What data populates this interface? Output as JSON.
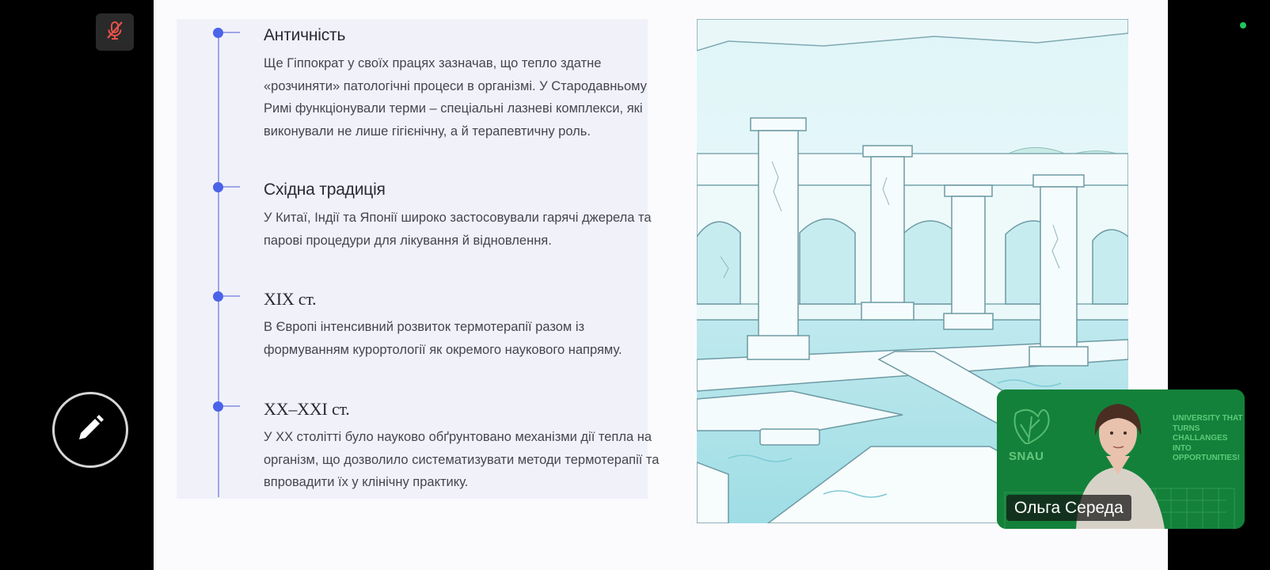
{
  "controls": {
    "mic_icon": "microphone-muted-icon",
    "edit_icon": "pencil-icon",
    "mic_color": "#e8524a"
  },
  "slide": {
    "timeline": [
      {
        "heading": "Античність",
        "text": "Ще Гіппократ у своїх працях зазначав, що тепло здатне «розчиняти» патологічні процеси в організмі. У Стародавньому Римі функціонували терми – спеціальні лазневі комплекси, які виконували не лише гігієнічну, а й терапевтичну роль."
      },
      {
        "heading": "Східна традиція",
        "text": "У Китаї, Індії та Японії широко застосовували гарячі джерела та парові процедури для лікування й відновлення."
      },
      {
        "heading": "XIX ст.",
        "text": "В Європі інтенсивний розвиток термотерапії разом із формуванням курортології як окремого наукового напряму."
      },
      {
        "heading": "XX–XXI ст.",
        "text": "У XX столітті було науково обґрунтовано механізми дії тепла на організм, що дозволило систематизувати методи термотерапії та впровадити їх у клінічну практику."
      }
    ],
    "accent_color": "#4a63e8"
  },
  "camera": {
    "participant_name": "Ольга Середа",
    "logo_text": "SNAU",
    "slogan": "UNIVERSITY THAT TURNS CHALLANGES INTO OPPORTUNITIES!",
    "background_color": "#13813a"
  }
}
